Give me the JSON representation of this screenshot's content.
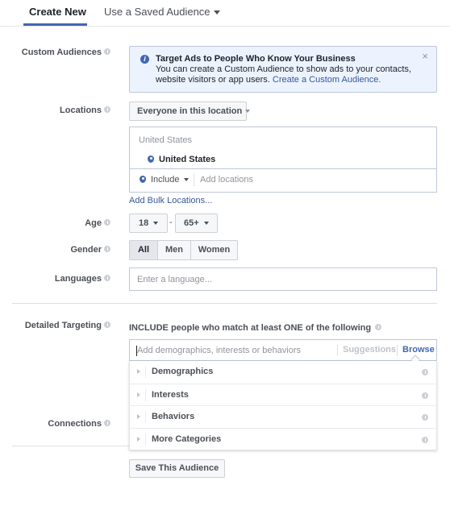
{
  "tabs": {
    "create_new": "Create New",
    "use_saved": "Use a Saved Audience"
  },
  "custom_audiences": {
    "label": "Custom Audiences",
    "info_title": "Target Ads to People Who Know Your Business",
    "info_body": "You can create a Custom Audience to show ads to your contacts, website visitors or app users.",
    "info_link": "Create a Custom Audience.",
    "close_glyph": "×"
  },
  "locations": {
    "label": "Locations",
    "dropdown_value": "Everyone in this location",
    "country_header": "United States",
    "selected_item": "United States",
    "include_label": "Include",
    "add_placeholder": "Add locations",
    "bulk_link": "Add Bulk Locations..."
  },
  "age": {
    "label": "Age",
    "from": "18",
    "separator": "-",
    "to": "65+"
  },
  "gender": {
    "label": "Gender",
    "options": [
      "All",
      "Men",
      "Women"
    ],
    "selected": "All"
  },
  "languages": {
    "label": "Languages",
    "placeholder": "Enter a language..."
  },
  "detailed_targeting": {
    "label": "Detailed Targeting",
    "heading": "INCLUDE people who match at least ONE of the following",
    "placeholder": "Add demographics, interests or behaviors",
    "suggestions": "Suggestions",
    "browse": "Browse",
    "categories": [
      "Demographics",
      "Interests",
      "Behaviors",
      "More Categories"
    ]
  },
  "connections": {
    "label": "Connections"
  },
  "save_button": "Save This Audience",
  "colors": {
    "accent": "#4267b2",
    "link": "#365899",
    "info_bg": "#ecf3ff"
  }
}
